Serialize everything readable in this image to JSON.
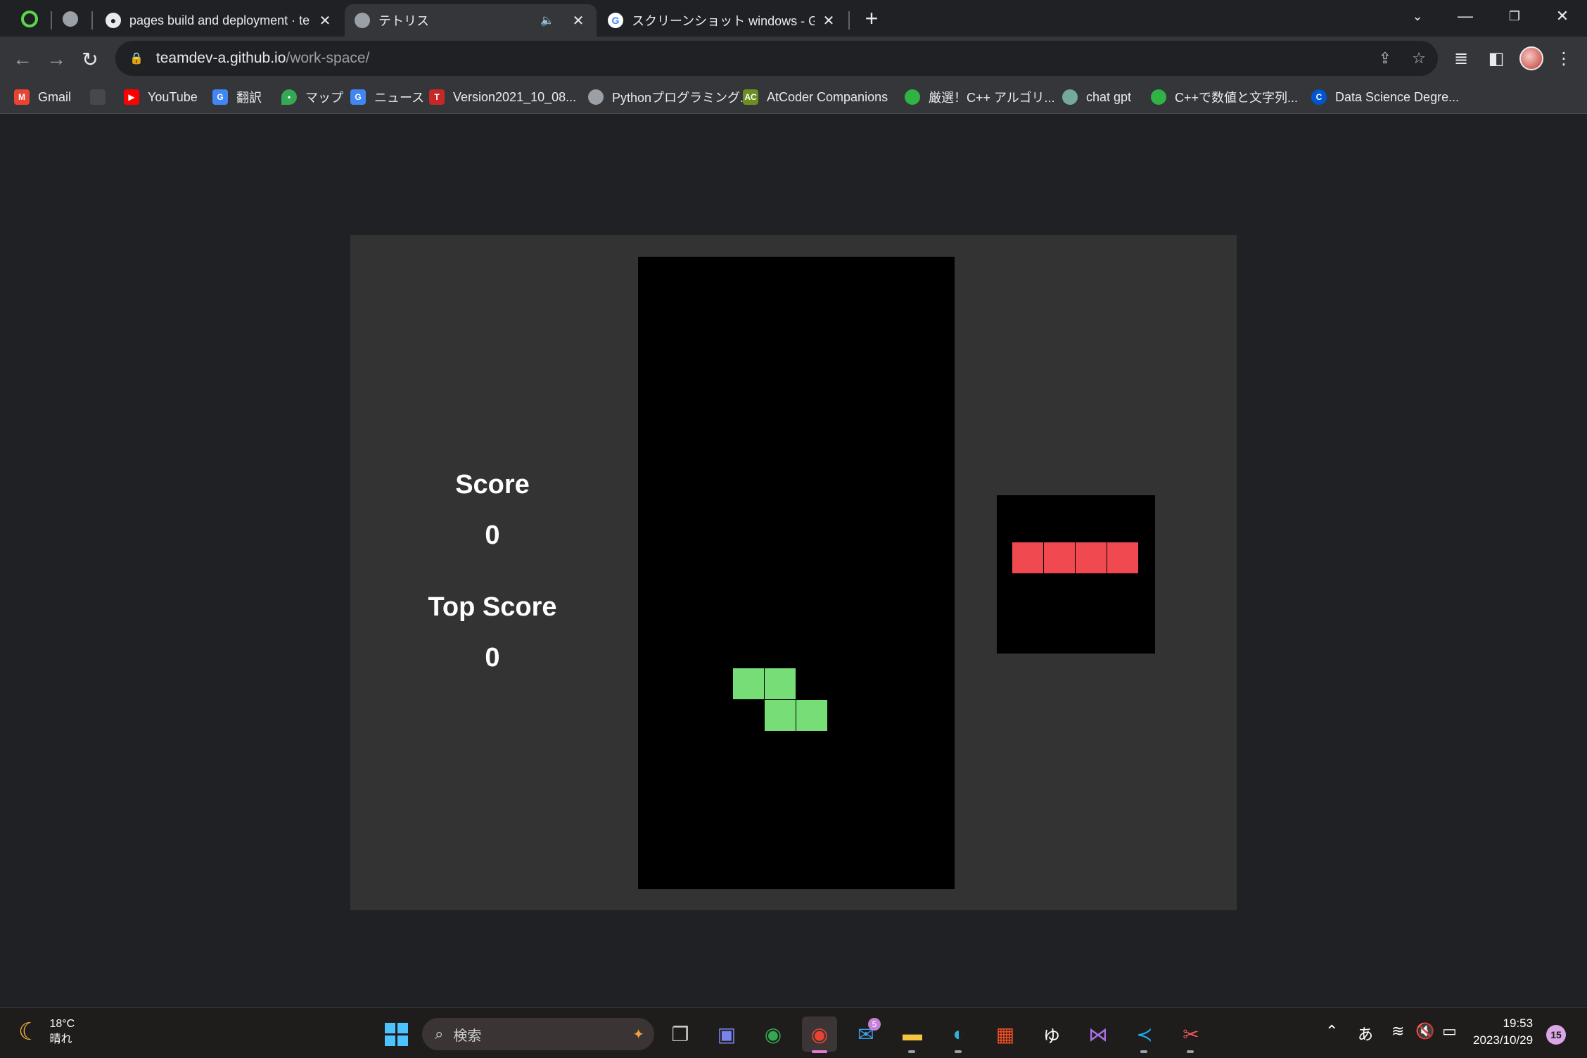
{
  "browser": {
    "tabs": [
      {
        "title": "pages build and deployment · te",
        "icon": "github-icon"
      },
      {
        "title": "テトリス",
        "icon": "globe-icon",
        "audio": "🔈"
      },
      {
        "title": "スクリーンショット windows - Googl",
        "icon": "google-icon"
      }
    ],
    "new_tab_label": "+",
    "url_host": "teamdev-a.github.io",
    "url_path": "/work-space/",
    "bookmarks": [
      {
        "label": "Gmail",
        "icon": "gmail-icon"
      },
      {
        "label": "YouTube",
        "icon": "youtube-icon"
      },
      {
        "label": "翻訳",
        "icon": "translate-icon"
      },
      {
        "label": "マップ",
        "icon": "maps-icon"
      },
      {
        "label": "ニュース",
        "icon": "news-icon"
      },
      {
        "label": "Version2021_10_08...",
        "icon": "version-icon"
      },
      {
        "label": "Pythonプログラミング...",
        "icon": "globe-icon"
      },
      {
        "label": "AtCoder Companions",
        "icon": "atcoder-icon"
      },
      {
        "label": "厳選！C++ アルゴリ...",
        "icon": "green-icon"
      },
      {
        "label": "chat gpt",
        "icon": "chatgpt-icon"
      },
      {
        "label": "C++で数値と文字列...",
        "icon": "green-icon"
      },
      {
        "label": "Data Science Degre...",
        "icon": "coursera-icon"
      }
    ]
  },
  "game": {
    "score_label": "Score",
    "score_value": "0",
    "top_score_label": "Top Score",
    "top_score_value": "0",
    "active_piece_color": "#77dd77",
    "next_piece_color": "#f04a50"
  },
  "taskbar": {
    "temperature": "18°C",
    "weather": "晴れ",
    "search_placeholder": "検索",
    "mail_badge": "5",
    "ime": "あ",
    "time": "19:53",
    "date": "2023/10/29",
    "notifications": "15"
  }
}
